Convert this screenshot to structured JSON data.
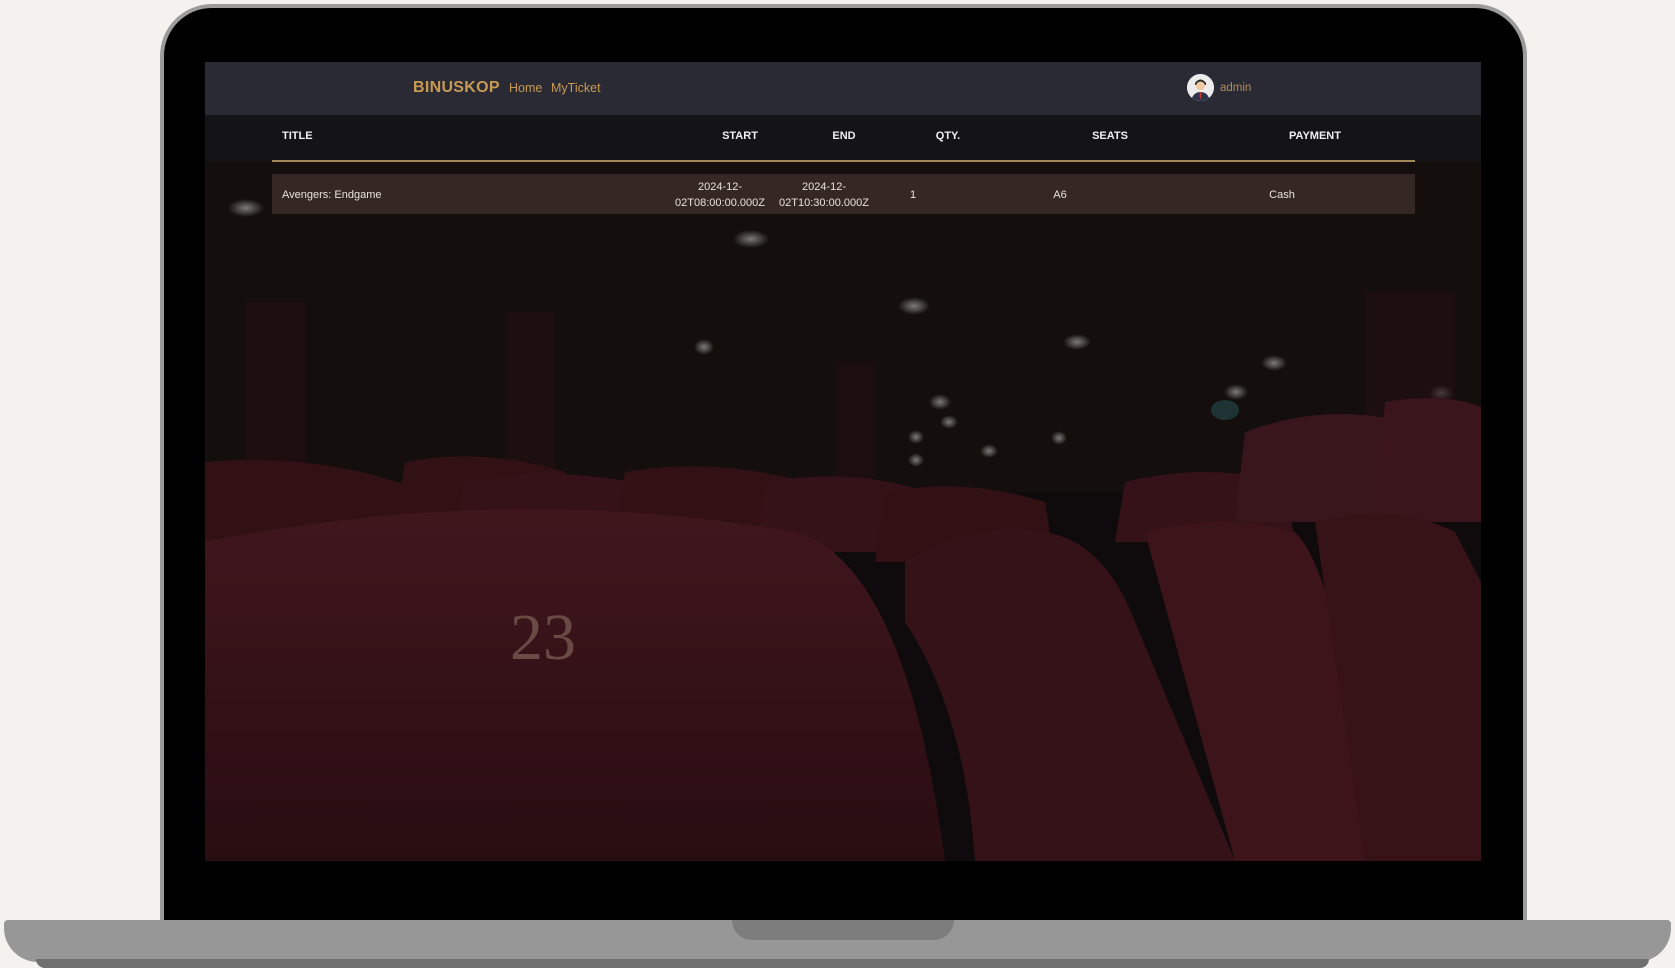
{
  "navbar": {
    "brand": "BINUSKOP",
    "links": [
      "Home",
      "MyTicket"
    ],
    "username": "admin"
  },
  "table": {
    "columns": [
      "TITLE",
      "START",
      "END",
      "QTY.",
      "SEATS",
      "PAYMENT"
    ],
    "rows": [
      {
        "title": "Avengers: Endgame",
        "start_line1": "2024-12-",
        "start_line2": "02T08:00:00.000Z",
        "end_line1": "2024-12-",
        "end_line2": "02T10:30:00.000Z",
        "qty": "1",
        "seats": "A6",
        "payment": "Cash"
      }
    ]
  },
  "background": {
    "seat_number": "23"
  },
  "colors": {
    "brand": "#c99a55",
    "navbar": "#292a33",
    "table_header": "#141416",
    "rule": "#a2875a"
  }
}
